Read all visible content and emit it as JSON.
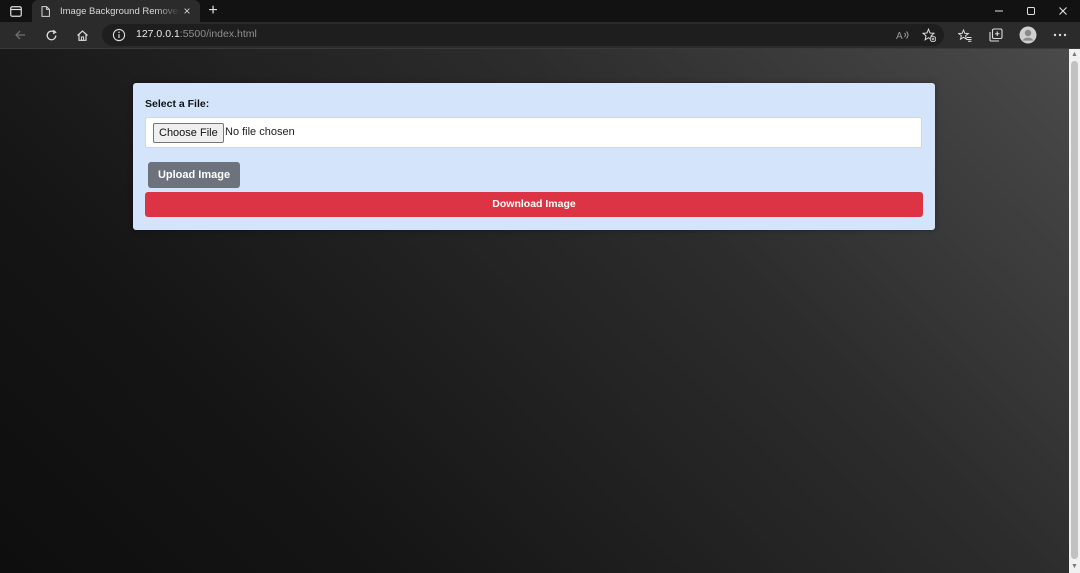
{
  "browser": {
    "tab": {
      "title": "Image Background Remover",
      "close_glyph": "×",
      "favicon_icon": "page-icon"
    },
    "new_tab_glyph": "+",
    "address": {
      "url_host": "127.0.0.1",
      "url_rest": ":5500/index.html",
      "info_icon": "info-icon"
    },
    "icons": {
      "back": "back-arrow-icon",
      "refresh": "refresh-icon",
      "home": "home-icon",
      "read_aloud": "read-aloud-icon",
      "add_favorite": "add-favorite-icon",
      "favorites": "favorites-icon",
      "collections": "collections-icon",
      "profile": "profile-avatar-icon",
      "more": "more-icon",
      "minimize": "minimize-icon",
      "maximize": "maximize-icon",
      "close": "close-window-icon"
    }
  },
  "page": {
    "form": {
      "label": "Select a File:",
      "choose_button": "Choose File",
      "file_status": "No file chosen",
      "upload_button": "Upload Image",
      "download_button": "Download Image"
    },
    "colors": {
      "card_background": "#d4e5fb",
      "upload_button": "#6c737d",
      "download_button": "#dc3445"
    }
  }
}
